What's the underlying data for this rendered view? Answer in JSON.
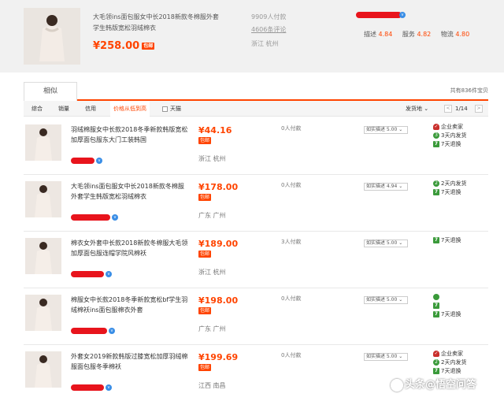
{
  "top_product": {
    "title": "大毛领ins面包服女中长2018新款冬棉服外套学生韩版宽松羽绒棉衣",
    "price": "¥258.00",
    "baoyou": "包邮",
    "paid": "9909人付款",
    "reviews": "4606条评论",
    "location": "浙江 杭州",
    "scores": [
      {
        "label": "描述",
        "value": "4.84"
      },
      {
        "label": "服务",
        "value": "4.82"
      },
      {
        "label": "物流",
        "value": "4.80"
      }
    ]
  },
  "tabs": {
    "similar": "相似",
    "total": "共有836件宝贝"
  },
  "sort": {
    "items": [
      "综合",
      "销量",
      "信用",
      "价格从低到高"
    ],
    "tmall": "天猫",
    "ship_from": "发货地",
    "page": "1/14",
    "prev": "<",
    "next": ">"
  },
  "products": [
    {
      "title": "羽绒棉服女中长款2018冬季新款韩版宽松加厚面包服东大门工装韩国",
      "price": "¥44.16",
      "baoyou": "包邮",
      "location": "浙江 杭州",
      "paid": "0人付款",
      "desc": "如实描述 5.00",
      "services": [
        {
          "icon": "store-icon",
          "glyph": "✓",
          "label": "企业卖家"
        },
        {
          "icon": "ship-icon",
          "glyph": "3",
          "label": "3天内发货"
        },
        {
          "icon": "return-icon",
          "glyph": "7",
          "label": "7天退换"
        }
      ]
    },
    {
      "title": "大毛领ins面包服女中长2018新款冬棉服外套学生韩版宽松羽绒棉衣",
      "price": "¥178.00",
      "baoyou": "包邮",
      "location": "广东 广州",
      "paid": "0人付款",
      "desc": "如实描述 4.94",
      "services": [
        {
          "icon": "ship-icon",
          "glyph": "2",
          "label": "2天内发货"
        },
        {
          "icon": "return-icon",
          "glyph": "7",
          "label": "7天退换"
        }
      ]
    },
    {
      "title": "棉衣女外套中长款2018新款冬棉服大毛领加厚面包服连帽学院风棉袄",
      "price": "¥189.00",
      "baoyou": "包邮",
      "location": "浙江 杭州",
      "paid": "3人付款",
      "desc": "如实描述 5.00",
      "services": [
        {
          "icon": "return-icon",
          "glyph": "7",
          "label": "7天退换"
        }
      ]
    },
    {
      "title": "棉服女中长款2018冬季新款宽松bf学生羽绒棉袄ins面包服棉衣外套",
      "price": "¥198.00",
      "baoyou": "包邮",
      "location": "广东 广州",
      "paid": "0人付款",
      "desc": "如实描述 5.00",
      "services": [
        {
          "icon": "ship-icon",
          "glyph": "",
          "label": ""
        },
        {
          "icon": "return-icon",
          "glyph": "7",
          "label": ""
        },
        {
          "icon": "return-icon",
          "glyph": "7",
          "label": "7天退换"
        }
      ]
    },
    {
      "title": "外套女2019新款韩版过膝宽松加厚羽绒棉服面包服冬季棉袄",
      "price": "¥199.69",
      "baoyou": "包邮",
      "location": "江西 南昌",
      "paid": "0人付款",
      "desc": "如实描述 5.00",
      "services": [
        {
          "icon": "store-icon",
          "glyph": "✓",
          "label": "企业卖家"
        },
        {
          "icon": "ship-icon",
          "glyph": "2",
          "label": "2天内发货"
        },
        {
          "icon": "return-icon",
          "glyph": "7",
          "label": "7天退换"
        }
      ]
    }
  ],
  "watermark": "头条@悟空问答"
}
